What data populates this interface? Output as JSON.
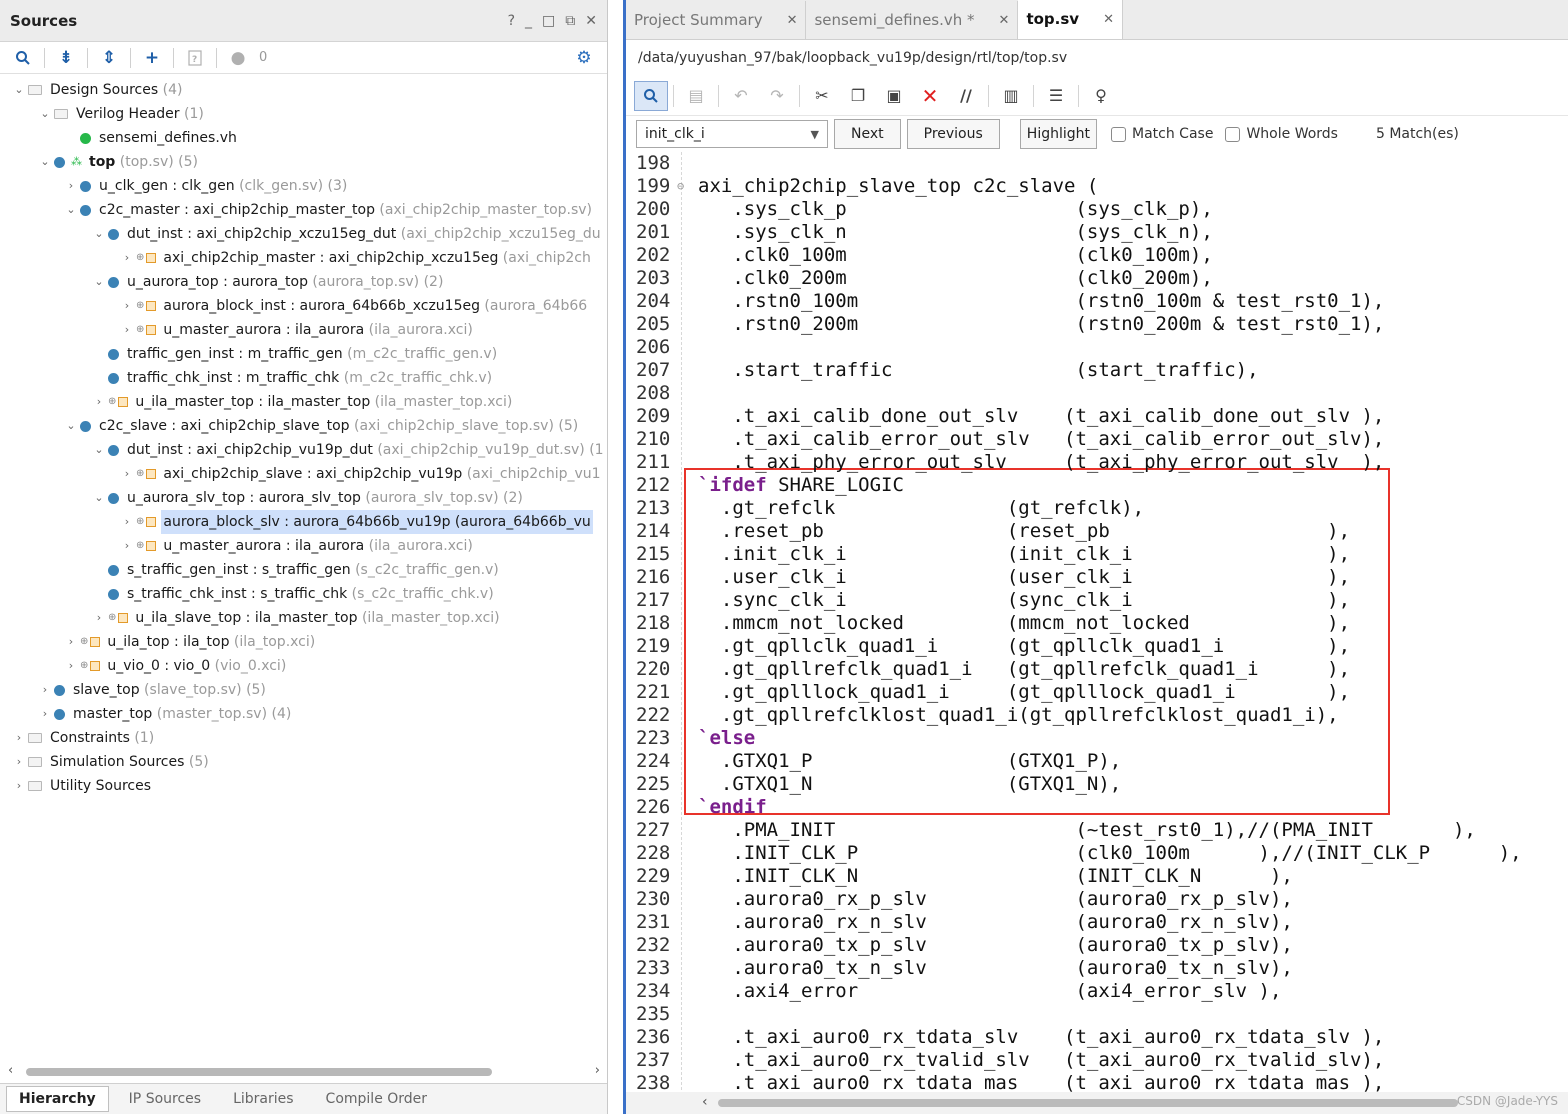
{
  "sources": {
    "title": "Sources",
    "controls": [
      "?",
      "_",
      "□",
      "⧉",
      "✕"
    ],
    "toolbar": {
      "match_count": "0"
    },
    "tree": [
      {
        "depth": 0,
        "chev": "v",
        "icon": "folder",
        "name": "Design Sources",
        "file": " (4)"
      },
      {
        "depth": 1,
        "chev": "v",
        "icon": "folder",
        "name": "Verilog Header",
        "file": " (1)"
      },
      {
        "depth": 2,
        "chev": "",
        "icon": "dot-green",
        "name": "sensemi_defines.vh",
        "file": ""
      },
      {
        "depth": 1,
        "chev": "v",
        "icon": "dot-blue-hier",
        "name": "top",
        "file": " (top.sv) (5)",
        "bold": true
      },
      {
        "depth": 2,
        "chev": ">",
        "icon": "dot-blue",
        "name": "u_clk_gen : clk_gen",
        "file": " (clk_gen.sv) (3)"
      },
      {
        "depth": 2,
        "chev": "v",
        "icon": "dot-blue",
        "name": "c2c_master : axi_chip2chip_master_top",
        "file": " (axi_chip2chip_master_top.sv)"
      },
      {
        "depth": 3,
        "chev": "v",
        "icon": "dot-blue",
        "name": "dut_inst : axi_chip2chip_xczu15eg_dut",
        "file": " (axi_chip2chip_xczu15eg_du"
      },
      {
        "depth": 4,
        "chev": ">",
        "icon": "ip",
        "name": "axi_chip2chip_master : axi_chip2chip_xczu15eg",
        "file": " (axi_chip2ch"
      },
      {
        "depth": 3,
        "chev": "v",
        "icon": "dot-blue",
        "name": "u_aurora_top : aurora_top",
        "file": " (aurora_top.sv) (2)"
      },
      {
        "depth": 4,
        "chev": ">",
        "icon": "ip",
        "name": "aurora_block_inst : aurora_64b66b_xczu15eg",
        "file": " (aurora_64b66"
      },
      {
        "depth": 4,
        "chev": ">",
        "icon": "ip",
        "name": "u_master_aurora : ila_aurora",
        "file": " (ila_aurora.xci)"
      },
      {
        "depth": 3,
        "chev": "",
        "icon": "dot-blue",
        "name": "traffic_gen_inst : m_traffic_gen",
        "file": " (m_c2c_traffic_gen.v)"
      },
      {
        "depth": 3,
        "chev": "",
        "icon": "dot-blue",
        "name": "traffic_chk_inst : m_traffic_chk",
        "file": " (m_c2c_traffic_chk.v)"
      },
      {
        "depth": 3,
        "chev": ">",
        "icon": "ip",
        "name": "u_ila_master_top : ila_master_top",
        "file": " (ila_master_top.xci)"
      },
      {
        "depth": 2,
        "chev": "v",
        "icon": "dot-blue",
        "name": "c2c_slave : axi_chip2chip_slave_top",
        "file": " (axi_chip2chip_slave_top.sv) (5)"
      },
      {
        "depth": 3,
        "chev": "v",
        "icon": "dot-blue",
        "name": "dut_inst : axi_chip2chip_vu19p_dut",
        "file": " (axi_chip2chip_vu19p_dut.sv) (1"
      },
      {
        "depth": 4,
        "chev": ">",
        "icon": "ip",
        "name": "axi_chip2chip_slave : axi_chip2chip_vu19p",
        "file": " (axi_chip2chip_vu1"
      },
      {
        "depth": 3,
        "chev": "v",
        "icon": "dot-blue",
        "name": "u_aurora_slv_top : aurora_slv_top",
        "file": " (aurora_slv_top.sv) (2)"
      },
      {
        "depth": 4,
        "chev": ">",
        "icon": "ip",
        "name": "aurora_block_slv : aurora_64b66b_vu19p (aurora_64b66b_vu",
        "file": "",
        "selected": true
      },
      {
        "depth": 4,
        "chev": ">",
        "icon": "ip",
        "name": "u_master_aurora : ila_aurora",
        "file": " (ila_aurora.xci)"
      },
      {
        "depth": 3,
        "chev": "",
        "icon": "dot-blue",
        "name": "s_traffic_gen_inst : s_traffic_gen",
        "file": " (s_c2c_traffic_gen.v)"
      },
      {
        "depth": 3,
        "chev": "",
        "icon": "dot-blue",
        "name": "s_traffic_chk_inst : s_traffic_chk",
        "file": " (s_c2c_traffic_chk.v)"
      },
      {
        "depth": 3,
        "chev": ">",
        "icon": "ip",
        "name": "u_ila_slave_top : ila_master_top",
        "file": " (ila_master_top.xci)"
      },
      {
        "depth": 2,
        "chev": ">",
        "icon": "ip",
        "name": "u_ila_top : ila_top",
        "file": " (ila_top.xci)"
      },
      {
        "depth": 2,
        "chev": ">",
        "icon": "ip",
        "name": "u_vio_0 : vio_0",
        "file": " (vio_0.xci)"
      },
      {
        "depth": 1,
        "chev": ">",
        "icon": "dot-blue",
        "name": "slave_top",
        "file": " (slave_top.sv) (5)"
      },
      {
        "depth": 1,
        "chev": ">",
        "icon": "dot-blue",
        "name": "master_top",
        "file": " (master_top.sv) (4)"
      },
      {
        "depth": 0,
        "chev": ">",
        "icon": "folder",
        "name": "Constraints",
        "file": " (1)"
      },
      {
        "depth": 0,
        "chev": ">",
        "icon": "folder",
        "name": "Simulation Sources",
        "file": " (5)"
      },
      {
        "depth": 0,
        "chev": ">",
        "icon": "folder",
        "name": "Utility Sources",
        "file": ""
      }
    ],
    "bottom_tabs": [
      "Hierarchy",
      "IP Sources",
      "Libraries",
      "Compile Order"
    ]
  },
  "editor": {
    "tabs": [
      {
        "label": "Project Summary",
        "active": false
      },
      {
        "label": "sensemi_defines.vh *",
        "active": false
      },
      {
        "label": "top.sv",
        "active": true
      }
    ],
    "file_path": "/data/yuyushan_97/bak/loopback_vu19p/design/rtl/top/top.sv",
    "find": {
      "value": "init_clk_i",
      "next_label": "Next",
      "previous_label": "Previous",
      "highlight_label": "Highlight",
      "match_case_label": "Match Case",
      "whole_words_label": "Whole Words",
      "matches": "5 Match(es)"
    },
    "lines": [
      {
        "n": "198",
        "t": ""
      },
      {
        "n": "199",
        "t": "axi_chip2chip_slave_top c2c_slave (",
        "fold": true
      },
      {
        "n": "200",
        "t": "   .sys_clk_p                    (sys_clk_p),"
      },
      {
        "n": "201",
        "t": "   .sys_clk_n                    (sys_clk_n),"
      },
      {
        "n": "202",
        "t": "   .clk0_100m                    (clk0_100m),"
      },
      {
        "n": "203",
        "t": "   .clk0_200m                    (clk0_200m),"
      },
      {
        "n": "204",
        "t": "   .rstn0_100m                   (rstn0_100m & test_rst0_1),"
      },
      {
        "n": "205",
        "t": "   .rstn0_200m                   (rstn0_200m & test_rst0_1),"
      },
      {
        "n": "206",
        "t": ""
      },
      {
        "n": "207",
        "t": "   .start_traffic                (start_traffic),"
      },
      {
        "n": "208",
        "t": ""
      },
      {
        "n": "209",
        "t": "   .t_axi_calib_done_out_slv    (t_axi_calib_done_out_slv ),"
      },
      {
        "n": "210",
        "t": "   .t_axi_calib_error_out_slv   (t_axi_calib_error_out_slv),"
      },
      {
        "n": "211",
        "t": "   .t_axi_phy_error_out_slv     (t_axi_phy_error_out_slv  ),"
      },
      {
        "n": "212",
        "kw": "`ifdef",
        "t": " SHARE_LOGIC"
      },
      {
        "n": "213",
        "t": "  .gt_refclk               (gt_refclk),"
      },
      {
        "n": "214",
        "t": "  .reset_pb                (reset_pb                   ),"
      },
      {
        "n": "215",
        "t": "  .init_clk_i              (init_clk_i                 ),"
      },
      {
        "n": "216",
        "t": "  .user_clk_i              (user_clk_i                 ),"
      },
      {
        "n": "217",
        "t": "  .sync_clk_i              (sync_clk_i                 ),"
      },
      {
        "n": "218",
        "t": "  .mmcm_not_locked         (mmcm_not_locked            ),"
      },
      {
        "n": "219",
        "t": "  .gt_qpllclk_quad1_i      (gt_qpllclk_quad1_i         ),"
      },
      {
        "n": "220",
        "t": "  .gt_qpllrefclk_quad1_i   (gt_qpllrefclk_quad1_i      ),"
      },
      {
        "n": "221",
        "t": "  .gt_qplllock_quad1_i     (gt_qplllock_quad1_i        ),"
      },
      {
        "n": "222",
        "t": "  .gt_qpllrefclklost_quad1_i(gt_qpllrefclklost_quad1_i),"
      },
      {
        "n": "223",
        "kw": "`else",
        "t": ""
      },
      {
        "n": "224",
        "t": "  .GTXQ1_P                 (GTXQ1_P),"
      },
      {
        "n": "225",
        "t": "  .GTXQ1_N                 (GTXQ1_N),"
      },
      {
        "n": "226",
        "kw": "`endif",
        "t": ""
      },
      {
        "n": "227",
        "t": "   .PMA_INIT                     (~test_rst0_1),//(PMA_INIT       ),"
      },
      {
        "n": "228",
        "t": "   .INIT_CLK_P                   (clk0_100m      ),//(INIT_CLK_P      ),"
      },
      {
        "n": "229",
        "t": "   .INIT_CLK_N                   (INIT_CLK_N      ),"
      },
      {
        "n": "230",
        "t": "   .aurora0_rx_p_slv             (aurora0_rx_p_slv),"
      },
      {
        "n": "231",
        "t": "   .aurora0_rx_n_slv             (aurora0_rx_n_slv),"
      },
      {
        "n": "232",
        "t": "   .aurora0_tx_p_slv             (aurora0_tx_p_slv),"
      },
      {
        "n": "233",
        "t": "   .aurora0_tx_n_slv             (aurora0_tx_n_slv),"
      },
      {
        "n": "234",
        "t": "   .axi4_error                   (axi4_error_slv ),"
      },
      {
        "n": "235",
        "t": ""
      },
      {
        "n": "236",
        "t": "   .t_axi_auro0_rx_tdata_slv    (t_axi_auro0_rx_tdata_slv ),"
      },
      {
        "n": "237",
        "t": "   .t_axi_auro0_rx_tvalid_slv   (t_axi_auro0_rx_tvalid_slv),"
      },
      {
        "n": "238",
        "t": "   .t_axi_auro0_rx_tdata_mas    (t_axi_auro0_rx_tdata_mas ),"
      }
    ]
  },
  "watermark": "CSDN @Jade-YYS"
}
